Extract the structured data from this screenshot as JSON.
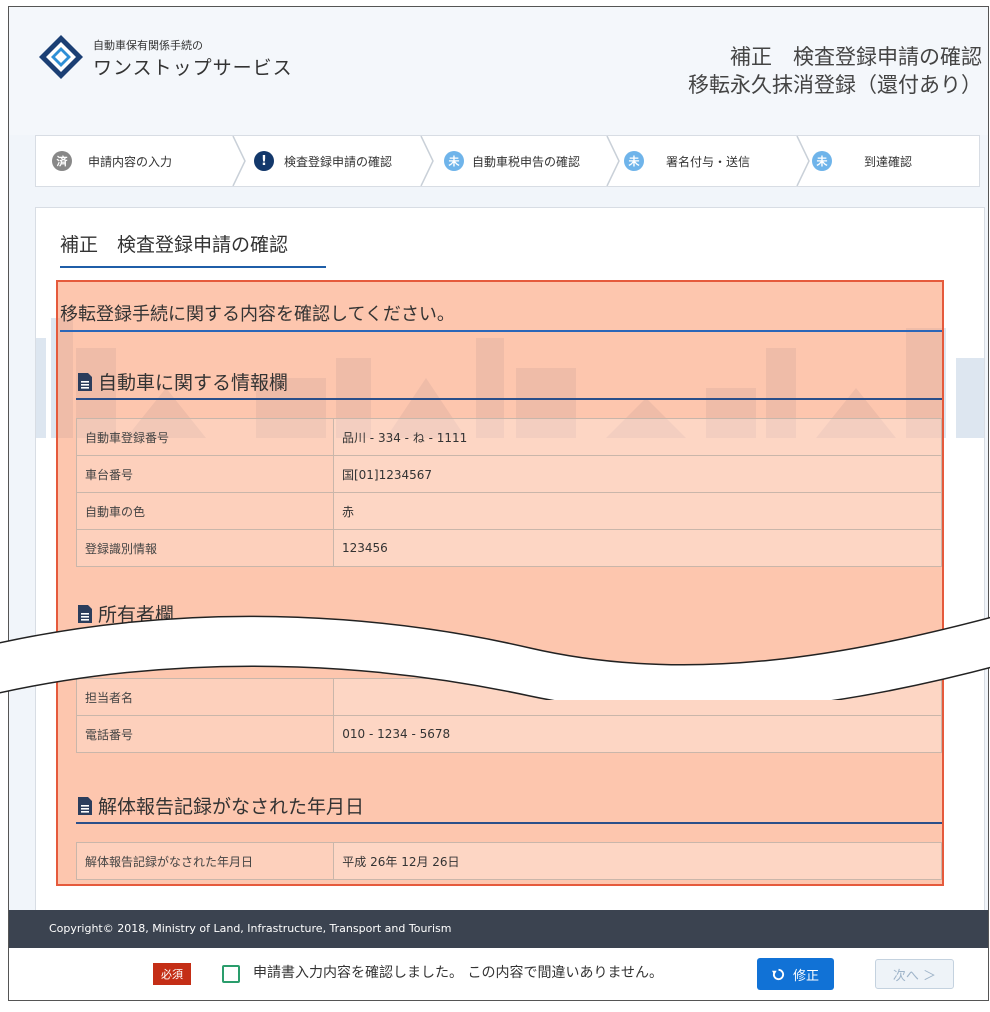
{
  "header": {
    "brand_small": "自動車保有関係手続の",
    "brand_large": "ワンストップサービス",
    "heading_line1": "補正　検査登録申請の確認",
    "heading_line2": "移転永久抹消登録（還付あり）"
  },
  "steps": [
    {
      "icon": "済",
      "label": "申請内容の入力",
      "state": "done"
    },
    {
      "icon": "!",
      "label": "検査登録申請の確認",
      "state": "current"
    },
    {
      "icon": "未",
      "label": "自動車税申告の確認",
      "state": "pending"
    },
    {
      "icon": "未",
      "label": "署名付与・送信",
      "state": "pending"
    },
    {
      "icon": "未",
      "label": "到達確認",
      "state": "pending"
    }
  ],
  "panel": {
    "title": "補正　検査登録申請の確認",
    "intro": "移転登録手続に関する内容を確認してください。"
  },
  "sections": {
    "vehicle": {
      "title": "自動車に関する情報欄",
      "rows": [
        {
          "label": "自動車登録番号",
          "value": "品川 - 334 - ね - 1111"
        },
        {
          "label": "車台番号",
          "value": "国[01]1234567"
        },
        {
          "label": "自動車の色",
          "value": "赤"
        },
        {
          "label": "登録識別情報",
          "value": "123456"
        }
      ]
    },
    "owner": {
      "title": "所有者欄",
      "rows": [
        {
          "label": "担当者名",
          "value": ""
        },
        {
          "label": "電話番号",
          "value": "010 - 1234 - 5678"
        }
      ]
    },
    "dismantle": {
      "title": "解体報告記録がなされた年月日",
      "rows": [
        {
          "label": "解体報告記録がなされた年月日",
          "value": "平成 26年 12月 26日"
        }
      ]
    }
  },
  "footer": {
    "copyright": "Copyright© 2018, Ministry of Land, Infrastructure, Transport and Tourism"
  },
  "actions": {
    "required": "必須",
    "confirm_text": "申請書入力内容を確認しました。 この内容で間違いありません。",
    "fix_label": "修正",
    "next_label": "次へ ＞"
  },
  "colors": {
    "accent": "#1172d6",
    "highlight": "#fca078",
    "highlight_border": "#e55a3c",
    "footer": "#3b4350"
  }
}
